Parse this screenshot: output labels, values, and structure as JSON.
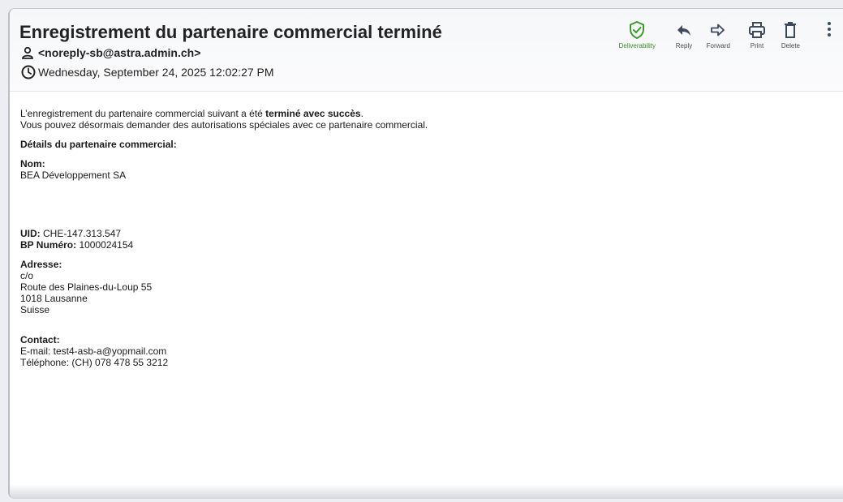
{
  "email": {
    "subject": "Enregistrement du partenaire commercial terminé",
    "sender": "<noreply-sb@astra.admin.ch>",
    "date": "Wednesday, September 24, 2025 12:02:27 PM"
  },
  "toolbar": {
    "deliverability_label": "Deliverability",
    "reply_label": "Reply",
    "forward_label": "Forward",
    "print_label": "Print",
    "delete_label": "Delete"
  },
  "body": {
    "intro_prefix": "L’enregistrement du partenaire commercial suivant a été ",
    "intro_bold": "terminé avec succès",
    "intro_suffix": ".",
    "intro_line2": "Vous pouvez désormais demander des autorisations spéciales avec ce partenaire commercial.",
    "details_heading": "Détails du partenaire commercial:",
    "nom_label": "Nom:",
    "nom_value": "BEA Développement SA",
    "uid_label": "UID:",
    "uid_value": " CHE-147.313.547",
    "bp_label": "BP Numéro:",
    "bp_value": " 1000024154",
    "adresse_label": "Adresse:",
    "adresse_line1": "c/o",
    "adresse_line2": "Route des Plaines-du-Loup 55",
    "adresse_line3": "1018 Lausanne",
    "adresse_line4": "Suisse",
    "contact_label": "Contact:",
    "contact_email": "E-mail: test4-asb-a@yopmail.com",
    "contact_phone": "Téléphone: (CH) 078 478 55 3212"
  },
  "colors": {
    "deliverability": "#3a9a2a",
    "icon": "#3c4a5c"
  },
  "icons": [
    "person-icon",
    "clock-icon",
    "shield-check-icon",
    "reply-icon",
    "forward-icon",
    "printer-icon",
    "trash-icon",
    "more-vertical-icon"
  ]
}
